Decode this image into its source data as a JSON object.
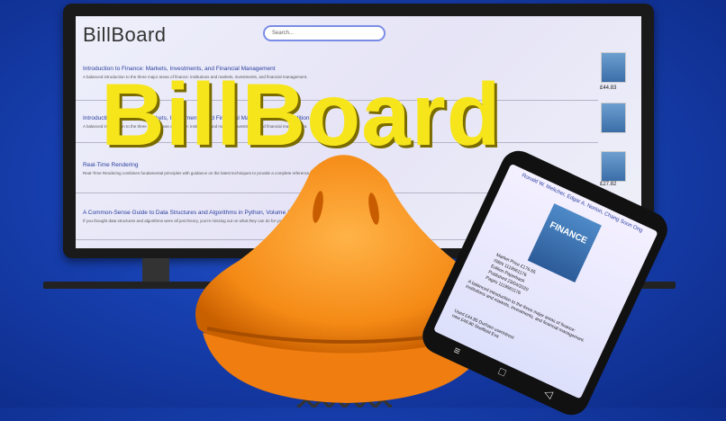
{
  "title": "BillBoard",
  "site": {
    "logo": "BillBoard",
    "search_placeholder": "Search..."
  },
  "books": [
    {
      "title": "Introduction to Finance: Markets, Investments, and Financial Management",
      "desc": "A balanced introduction to the three major areas of finance: institutions and markets, investments, and financial management.",
      "price": "£44.83"
    },
    {
      "title": "Introduction to Finance: Markets, Investments, and Financial Management, 16th Edition",
      "desc": "A balanced introduction to the three major areas of finance: institutions and markets, investments, and financial management.",
      "price": ""
    },
    {
      "title": "Real-Time Rendering",
      "desc": "Real-Time Rendering combines fundamental principles with guidance on the latest techniques to provide a complete reference.",
      "price": "£27.82"
    },
    {
      "title": "A Common-Sense Guide to Data Structures and Algorithms in Python, Volume 1: Level Up Your Core Programming Skills",
      "desc": "If you thought data structures and algorithms were all just theory, you're missing out on what they can do for your code.",
      "price": ""
    }
  ],
  "phone": {
    "authors": "Ronald W. Melicher, Edgar A. Norton, Chang Soon Ong",
    "cover": "FINANCE",
    "meta": [
      "Market Price  £176.65",
      "ISBN  1119561176",
      "Edition  Paperback",
      "Published  23/04/2020",
      "Pages  1119561176"
    ],
    "desc": "A balanced introduction to the three major areas of finance: institutions and markets, investments, and financial management.",
    "table": [
      "Used  £44.85  Durham  userintrest",
      "new  £49.80  Sheffield  Eva"
    ]
  }
}
